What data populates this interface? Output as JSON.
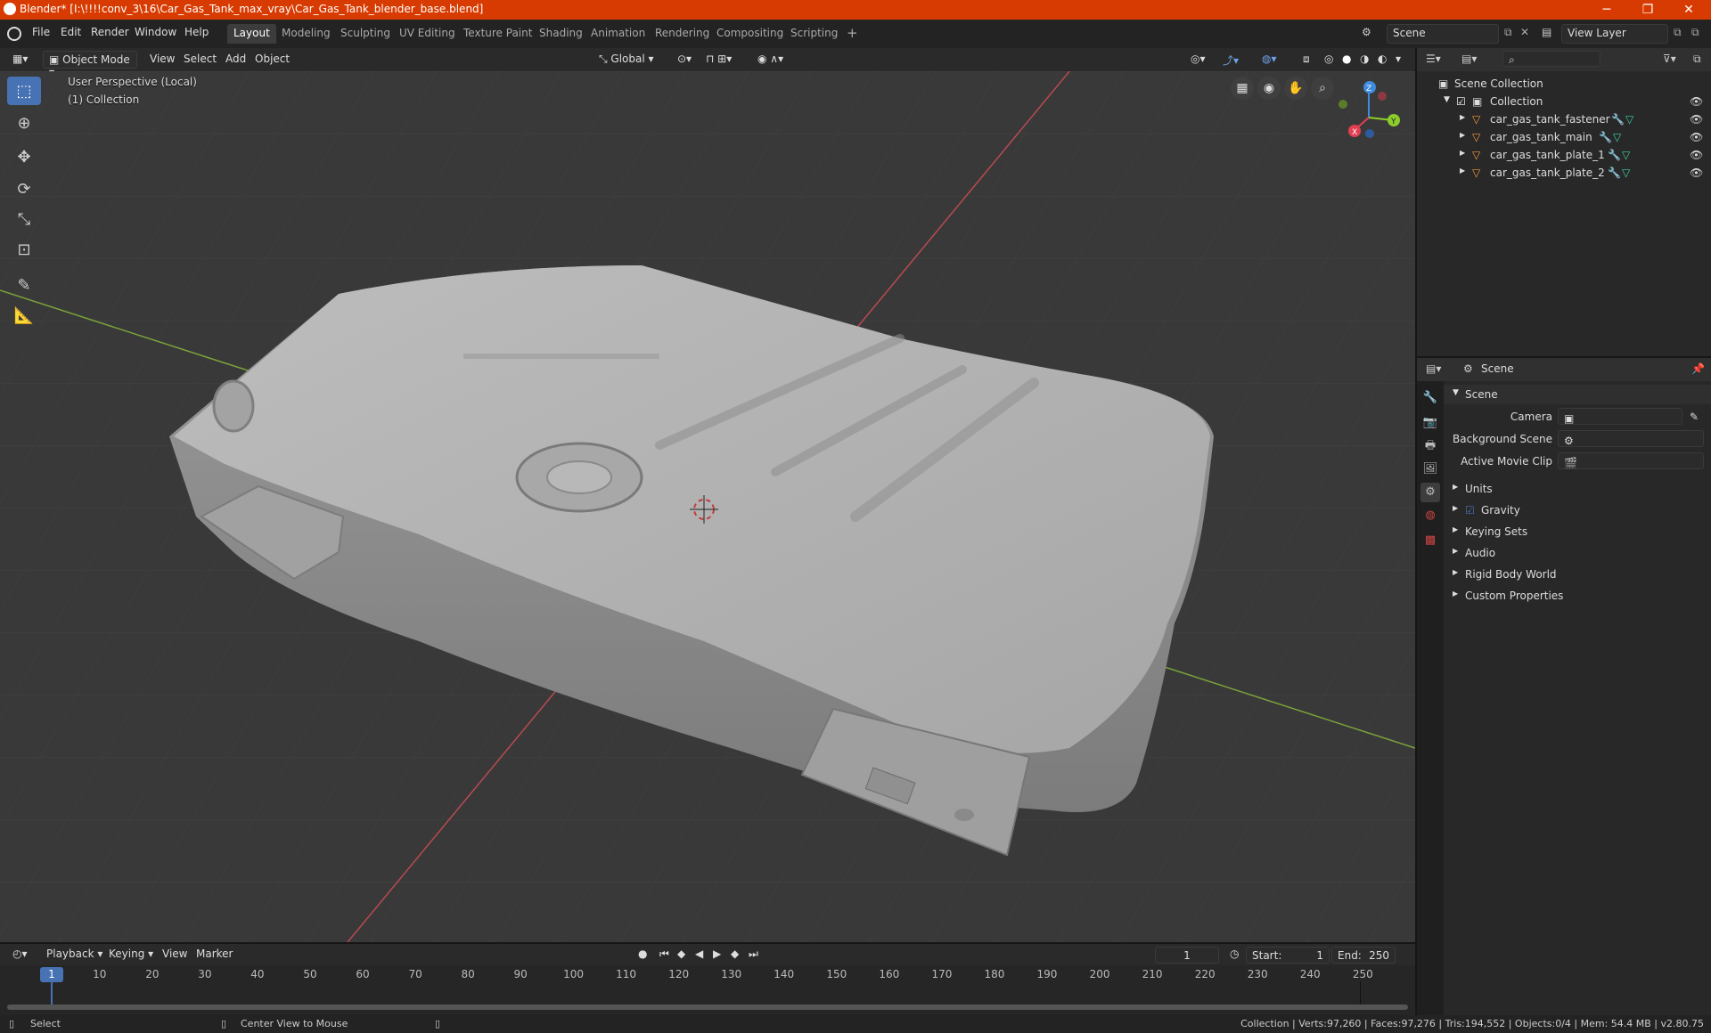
{
  "title_bar": {
    "title": "Blender* [I:\\!!!!conv_3\\16\\Car_Gas_Tank_max_vray\\Car_Gas_Tank_blender_base.blend]",
    "minimize": "─",
    "maximize": "❐",
    "close": "✕"
  },
  "menus": [
    "File",
    "Edit",
    "Render",
    "Window",
    "Help"
  ],
  "workspaces": [
    "Layout",
    "Modeling",
    "Sculpting",
    "UV Editing",
    "Texture Paint",
    "Shading",
    "Animation",
    "Rendering",
    "Compositing",
    "Scripting",
    "+"
  ],
  "scene_field": "Scene",
  "view_layer_field": "View Layer",
  "viewport_header": {
    "mode": "Object Mode",
    "menus": [
      "View",
      "Select",
      "Add",
      "Object"
    ],
    "orientation": "Global"
  },
  "viewport": {
    "perspective": "User Perspective (Local)",
    "collection": "(1) Collection"
  },
  "gizmo": {
    "z": "Z",
    "x": "X",
    "y": "Y"
  },
  "outliner": {
    "root": "Scene Collection",
    "collection": "Collection",
    "objects": [
      "car_gas_tank_fastener",
      "car_gas_tank_main",
      "car_gas_tank_plate_1",
      "car_gas_tank_plate_2"
    ]
  },
  "properties": {
    "context": "Scene",
    "panel": "Scene",
    "camera_label": "Camera",
    "bg_scene_label": "Background Scene",
    "movie_clip_label": "Active Movie Clip",
    "sections": [
      "Units",
      "Gravity",
      "Keying Sets",
      "Audio",
      "Rigid Body World",
      "Custom Properties"
    ]
  },
  "timeline": {
    "menus": [
      "Playback",
      "Keying",
      "View",
      "Marker"
    ],
    "current_frame": "1",
    "start_label": "Start:",
    "start": "1",
    "end_label": "End:",
    "end": "250",
    "ticks": [
      "1",
      "10",
      "20",
      "30",
      "40",
      "50",
      "60",
      "70",
      "80",
      "90",
      "100",
      "110",
      "120",
      "130",
      "140",
      "150",
      "160",
      "170",
      "180",
      "190",
      "200",
      "210",
      "220",
      "230",
      "240",
      "250"
    ]
  },
  "status": {
    "select": "Select",
    "center": "Center View to Mouse",
    "stats": "Collection | Verts:97,260 | Faces:97,276 | Tris:194,552 | Objects:0/4 | Mem: 54.4 MB | v2.80.75"
  },
  "colors": {
    "title_bar": "#d83b01",
    "active_tool": "#4772b3",
    "x_axis": "#e04050",
    "y_axis": "#8ccd2c",
    "z_axis": "#3e8ce0",
    "mesh_icon": "#f29a3a"
  }
}
